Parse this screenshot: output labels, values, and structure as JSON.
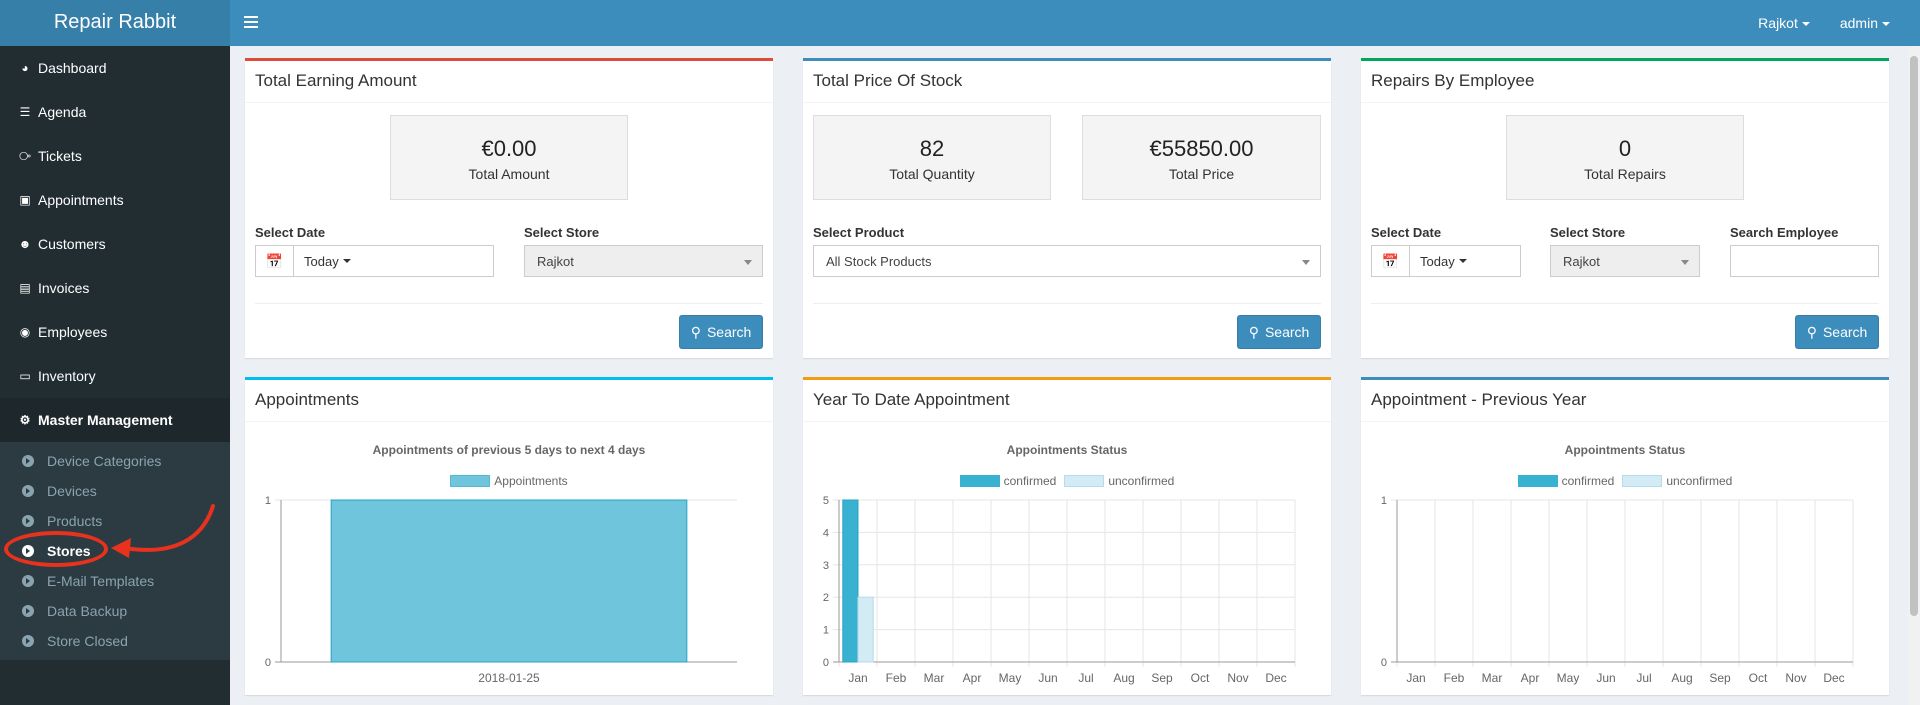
{
  "app": {
    "title": "Repair Rabbit"
  },
  "topbar": {
    "store": "Rajkot",
    "user": "admin"
  },
  "sidebar": {
    "items": [
      {
        "label": "Dashboard",
        "icon": "dashboard-icon"
      },
      {
        "label": "Agenda",
        "icon": "list-icon"
      },
      {
        "label": "Tickets",
        "icon": "ticket-icon"
      },
      {
        "label": "Appointments",
        "icon": "calendar-plus-icon"
      },
      {
        "label": "Customers",
        "icon": "users-icon"
      },
      {
        "label": "Invoices",
        "icon": "file-icon"
      },
      {
        "label": "Employees",
        "icon": "user-circle-icon"
      },
      {
        "label": "Inventory",
        "icon": "laptop-icon"
      },
      {
        "label": "Master Management",
        "icon": "cogs-icon"
      }
    ],
    "submenu": [
      {
        "label": "Device Categories"
      },
      {
        "label": "Devices"
      },
      {
        "label": "Products"
      },
      {
        "label": "Stores"
      },
      {
        "label": "E-Mail Templates"
      },
      {
        "label": "Data Backup"
      },
      {
        "label": "Store Closed"
      }
    ]
  },
  "earning": {
    "title": "Total Earning Amount",
    "amount": "€0.00",
    "amount_label": "Total Amount",
    "date_label": "Select Date",
    "date_value": "Today",
    "store_label": "Select Store",
    "store_value": "Rajkot",
    "search": "Search"
  },
  "stock": {
    "title": "Total Price Of Stock",
    "quantity": "82",
    "quantity_label": "Total Quantity",
    "price": "€55850.00",
    "price_label": "Total Price",
    "product_label": "Select Product",
    "product_value": "All Stock Products",
    "search": "Search"
  },
  "repairs": {
    "title": "Repairs By Employee",
    "count": "0",
    "count_label": "Total Repairs",
    "date_label": "Select Date",
    "date_value": "Today",
    "store_label": "Select Store",
    "store_value": "Rajkot",
    "employee_label": "Search Employee",
    "search": "Search"
  },
  "panels": {
    "appointments": {
      "title": "Appointments"
    },
    "ytd": {
      "title": "Year To Date Appointment"
    },
    "prev": {
      "title": "Appointment - Previous Year"
    }
  },
  "chart_data": [
    {
      "type": "bar",
      "title": "Appointments of previous 5 days to next 4 days",
      "categories": [
        "2018-01-25"
      ],
      "series": [
        {
          "name": "Appointments",
          "values": [
            1
          ]
        }
      ],
      "ylim": [
        0,
        1
      ],
      "yticks": [
        0,
        1
      ],
      "colors": [
        "#6ec5dc"
      ],
      "legend": "top"
    },
    {
      "type": "bar",
      "title": "Appointments Status",
      "categories": [
        "Jan",
        "Feb",
        "Mar",
        "Apr",
        "May",
        "Jun",
        "Jul",
        "Aug",
        "Sep",
        "Oct",
        "Nov",
        "Dec"
      ],
      "series": [
        {
          "name": "confirmed",
          "values": [
            5,
            0,
            0,
            0,
            0,
            0,
            0,
            0,
            0,
            0,
            0,
            0
          ]
        },
        {
          "name": "unconfirmed",
          "values": [
            2,
            0,
            0,
            0,
            0,
            0,
            0,
            0,
            0,
            0,
            0,
            0
          ]
        }
      ],
      "ylim": [
        0,
        5
      ],
      "yticks": [
        0,
        1,
        2,
        3,
        4,
        5
      ],
      "colors": [
        "#38b2d0",
        "#d2ebf4"
      ],
      "legend": "top"
    },
    {
      "type": "bar",
      "title": "Appointments Status",
      "categories": [
        "Jan",
        "Feb",
        "Mar",
        "Apr",
        "May",
        "Jun",
        "Jul",
        "Aug",
        "Sep",
        "Oct",
        "Nov",
        "Dec"
      ],
      "series": [
        {
          "name": "confirmed",
          "values": [
            0,
            0,
            0,
            0,
            0,
            0,
            0,
            0,
            0,
            0,
            0,
            0
          ]
        },
        {
          "name": "unconfirmed",
          "values": [
            0,
            0,
            0,
            0,
            0,
            0,
            0,
            0,
            0,
            0,
            0,
            0
          ]
        }
      ],
      "ylim": [
        0,
        1
      ],
      "yticks": [
        0,
        1
      ],
      "colors": [
        "#38b2d0",
        "#d2ebf4"
      ],
      "legend": "top"
    }
  ]
}
